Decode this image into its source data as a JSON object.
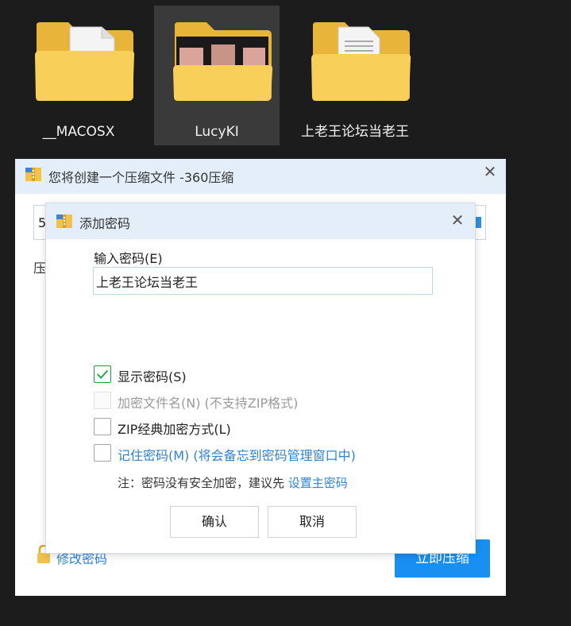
{
  "desktop": {
    "items": [
      {
        "label": "__MACOSX"
      },
      {
        "label": "LucyKI"
      },
      {
        "label": "上老王论坛当老王"
      }
    ]
  },
  "back_dialog": {
    "title": "您将创建一个压缩文件 -360压缩",
    "path_fragment": "5",
    "label_fragment": "压",
    "change_password_link": "修改密码",
    "compress_button": "立即压缩"
  },
  "password_dialog": {
    "title": "添加密码",
    "input_label": "输入密码(E)",
    "input_value": "上老王论坛当老王",
    "options": [
      {
        "label": "显示密码(S)",
        "checked": true,
        "disabled": false
      },
      {
        "label": "加密文件名(N) (不支持ZIP格式)",
        "checked": false,
        "disabled": true
      },
      {
        "label": "ZIP经典加密方式(L)",
        "checked": false,
        "disabled": false
      },
      {
        "label": "记住密码(M) (将会备忘到密码管理窗口中)",
        "checked": false,
        "disabled": false
      }
    ],
    "note_prefix": "注：密码没有安全加密，建议先 ",
    "note_link": "设置主密码",
    "confirm_button": "确认",
    "cancel_button": "取消"
  },
  "colors": {
    "titlebar": "#e4eef9",
    "accent": "#1a8ff2",
    "link": "#2d84d4",
    "check": "#18a33a",
    "folder": "#f7c94a"
  }
}
